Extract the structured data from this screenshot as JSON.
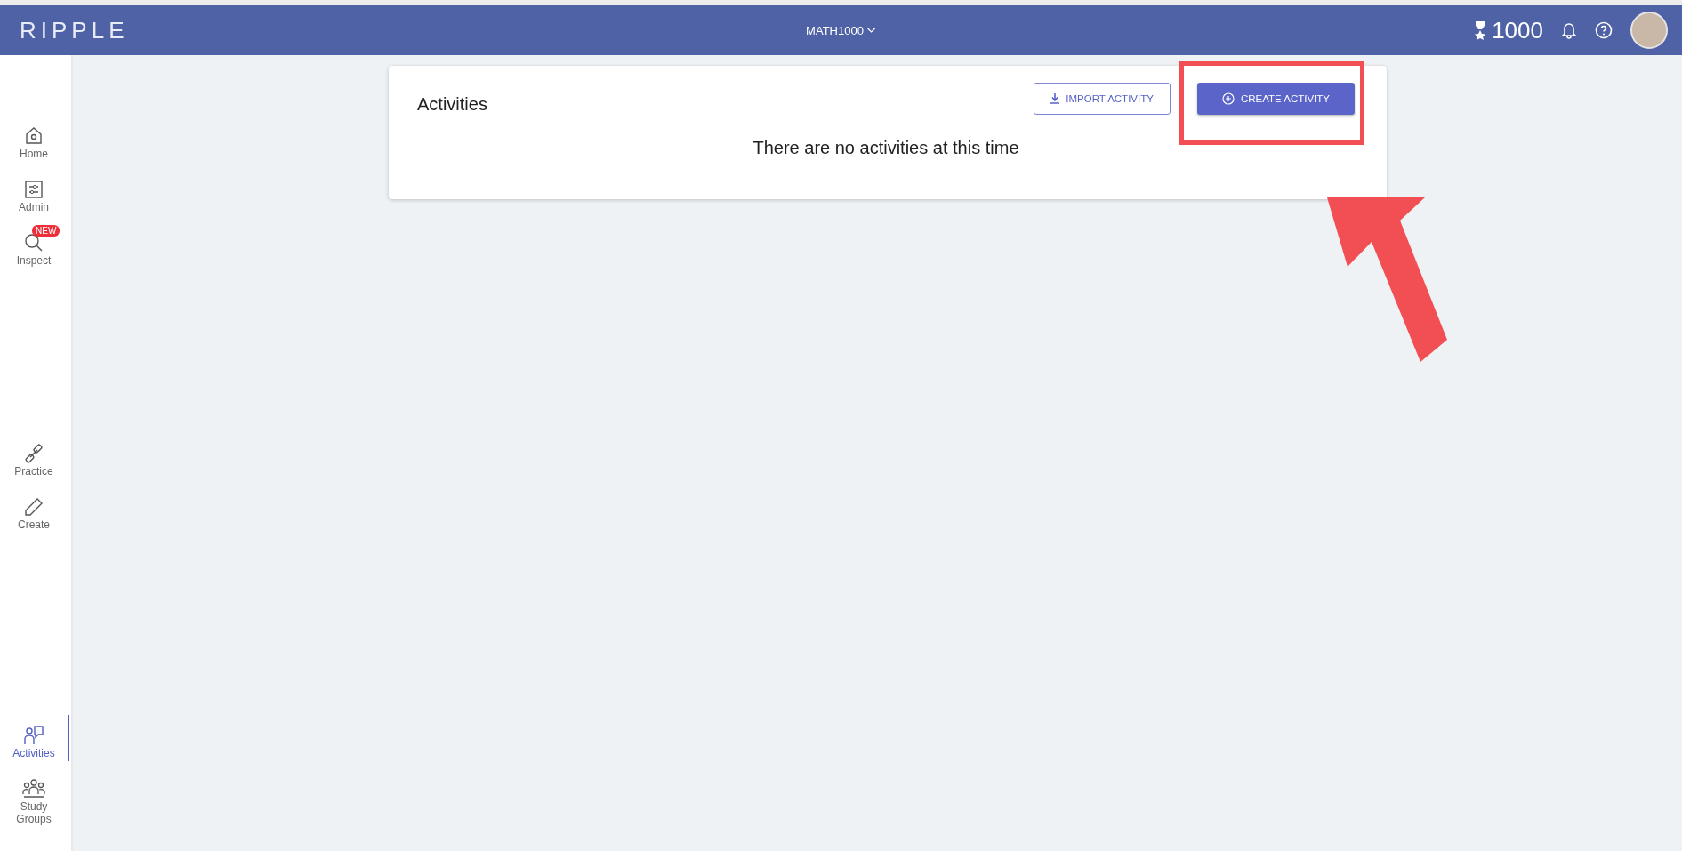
{
  "header": {
    "logo": "RIPPLE",
    "course": "MATH1000",
    "points": "1000"
  },
  "sidebar": {
    "groups": [
      {
        "items": [
          {
            "label": "Home",
            "selected": false
          },
          {
            "label": "Admin",
            "selected": false
          },
          {
            "label": "Inspect",
            "selected": false,
            "badge": "NEW"
          }
        ]
      },
      {
        "items": [
          {
            "label": "Practice",
            "selected": false
          },
          {
            "label": "Create",
            "selected": false
          }
        ]
      },
      {
        "items": [
          {
            "label": "Activities",
            "selected": true
          },
          {
            "label": "Study Groups",
            "selected": false
          }
        ]
      }
    ]
  },
  "card": {
    "title": "Activities",
    "buttons": [
      {
        "label": "IMPORT ACTIVITY",
        "kind": "outlined"
      },
      {
        "label": "CREATE ACTIVITY",
        "kind": "filled"
      }
    ],
    "message": "There are no activities at this time"
  }
}
